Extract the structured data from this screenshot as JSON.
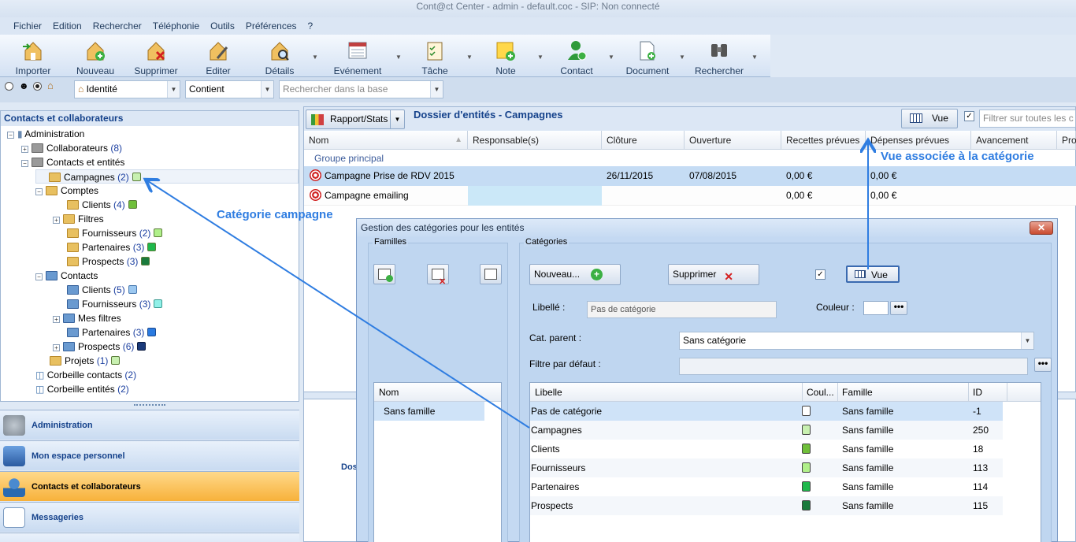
{
  "window_title": "Cont@ct Center - admin - default.coc - SIP: Non connecté",
  "menu": [
    "Fichier",
    "Edition",
    "Rechercher",
    "Téléphonie",
    "Outils",
    "Préférences",
    "?"
  ],
  "toolbar": {
    "importer": "Importer",
    "nouveau": "Nouveau",
    "supprimer": "Supprimer",
    "editer": "Editer",
    "details": "Détails",
    "evenement": "Evénement",
    "tache": "Tâche",
    "note": "Note",
    "contact": "Contact",
    "document": "Document",
    "rechercher": "Rechercher"
  },
  "search": {
    "field": "Identité",
    "operator": "Contient",
    "placeholder": "Rechercher dans la base"
  },
  "left_panel": {
    "title": "Contacts et collaborateurs",
    "tree": {
      "administration": "Administration",
      "collaborateurs": "Collaborateurs",
      "collaborateurs_count": "(8)",
      "contacts_entites": "Contacts et entités",
      "campagnes": "Campagnes",
      "campagnes_count": "(2)",
      "comptes": "Comptes",
      "clients_a": "Clients",
      "clients_a_count": "(4)",
      "filtres": "Filtres",
      "fournisseurs_a": "Fournisseurs",
      "fournisseurs_a_count": "(2)",
      "partenaires_a": "Partenaires",
      "partenaires_a_count": "(3)",
      "prospects_a": "Prospects",
      "prospects_a_count": "(3)",
      "contacts": "Contacts",
      "clients_b": "Clients",
      "clients_b_count": "(5)",
      "fournisseurs_b": "Fournisseurs",
      "fournisseurs_b_count": "(3)",
      "mes_filtres": "Mes filtres",
      "partenaires_b": "Partenaires",
      "partenaires_b_count": "(3)",
      "prospects_b": "Prospects",
      "prospects_b_count": "(6)",
      "projets": "Projets",
      "projets_count": "(1)",
      "corbeille_contacts": "Corbeille contacts",
      "corbeille_contacts_count": "(2)",
      "corbeille_entites": "Corbeille entités",
      "corbeille_entites_count": "(2)"
    },
    "nav": [
      "Administration",
      "Mon espace personnel",
      "Contacts et collaborateurs",
      "Messageries"
    ]
  },
  "main": {
    "rapport_btn": "Rapport/Stats",
    "title": "Dossier d'entités - Campagnes",
    "vue_btn": "Vue",
    "filter_placeholder": "Filtrer sur toutes les c",
    "columns": [
      "Nom",
      "Responsable(s)",
      "Clôture",
      "Ouverture",
      "Recettes prévues",
      "Dépenses prévues",
      "Avancement",
      "Pro"
    ],
    "group": "Groupe principal",
    "rows": [
      {
        "nom": "Campagne Prise de RDV 2015",
        "cloture": "26/11/2015",
        "ouverture": "07/08/2015",
        "recettes": "0,00 €",
        "depenses": "0,00 €"
      },
      {
        "nom": "Campagne emailing",
        "cloture": "",
        "ouverture": "",
        "recettes": "0,00 €",
        "depenses": "0,00 €"
      }
    ],
    "bottom_text": "Dos"
  },
  "dialog": {
    "title": "Gestion des catégories pour les entités",
    "familles_label": "Familles",
    "categories_label": "Catégories",
    "nouveau_btn": "Nouveau...",
    "supprimer_btn": "Supprimer",
    "vue_btn": "Vue",
    "libelle_label": "Libellé :",
    "libelle_value": "Pas de catégorie",
    "couleur_label": "Couleur :",
    "cat_parent_label": "Cat. parent :",
    "cat_parent_value": "Sans catégorie",
    "filtre_label": "Filtre par défaut :",
    "familles_col": "Nom",
    "familles_rows": [
      "Sans famille"
    ],
    "cat_columns": [
      "Libelle",
      "Coul...",
      "Famille",
      "ID"
    ],
    "cat_rows": [
      {
        "libelle": "Pas de catégorie",
        "color": "#ffffff",
        "famille": "Sans famille",
        "id": "-1"
      },
      {
        "libelle": "Campagnes",
        "color": "#c8f0b0",
        "famille": "Sans famille",
        "id": "250"
      },
      {
        "libelle": "Clients",
        "color": "#6fbf3a",
        "famille": "Sans famille",
        "id": "18"
      },
      {
        "libelle": "Fournisseurs",
        "color": "#b0f08a",
        "famille": "Sans famille",
        "id": "113"
      },
      {
        "libelle": "Partenaires",
        "color": "#1fb84c",
        "famille": "Sans famille",
        "id": "114"
      },
      {
        "libelle": "Prospects",
        "color": "#1a7a3c",
        "famille": "Sans famille",
        "id": "115"
      }
    ]
  },
  "annotations": {
    "categorie": "Catégorie campagne",
    "vue": "Vue associée à la catégorie"
  }
}
